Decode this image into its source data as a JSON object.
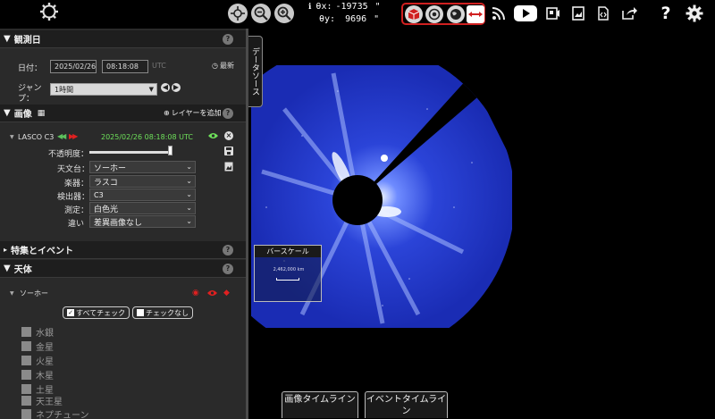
{
  "toolbar": {
    "coord_x_label": "θx:",
    "coord_x_value": "-19735",
    "coord_y_label": "θy:",
    "coord_y_value": "9696",
    "coord_unit": "\"",
    "help_glyph": "?"
  },
  "observation": {
    "title": "観測日",
    "date_label": "日付：",
    "date_value": "2025/02/26",
    "time_value": "08:18:08",
    "utc_label": "UTC",
    "latest_label": "最新",
    "jump_label": "ジャンプ：",
    "jump_value": "1時間"
  },
  "images": {
    "title": "画像",
    "add_layer_label": "レイヤーを追加",
    "layer_name": "LASCO C3",
    "layer_timestamp": "2025/02/26 08:18:08 UTC",
    "opacity_label": "不透明度：",
    "observatory_label": "天文台：",
    "observatory_value": "ソーホー",
    "instrument_label": "楽器：",
    "instrument_value": "ラスコ",
    "detector_label": "検出器：",
    "detector_value": "C3",
    "measurement_label": "測定：",
    "measurement_value": "白色光",
    "difference_label": "違い",
    "difference_value": "差異画像なし"
  },
  "features": {
    "title": "特集とイベント"
  },
  "bodies": {
    "title": "天体",
    "group_label": "ソーホー",
    "check_all": "すべてチェック",
    "check_none": "チェックなし",
    "items": [
      "水銀",
      "金星",
      "火星",
      "木星",
      "土星",
      "天王星",
      "ネプチューン"
    ]
  },
  "viewer": {
    "data_sources_tab": "データソース",
    "scale_title": "バースケール",
    "scale_value": "2,462,000 km",
    "image_timeline": "画像タイムライン",
    "event_timeline": "イベントタイムライン"
  },
  "colors": {
    "accent_green": "#6ee05a",
    "accent_red": "#e02020",
    "panel_bg": "#2a2a2a"
  }
}
